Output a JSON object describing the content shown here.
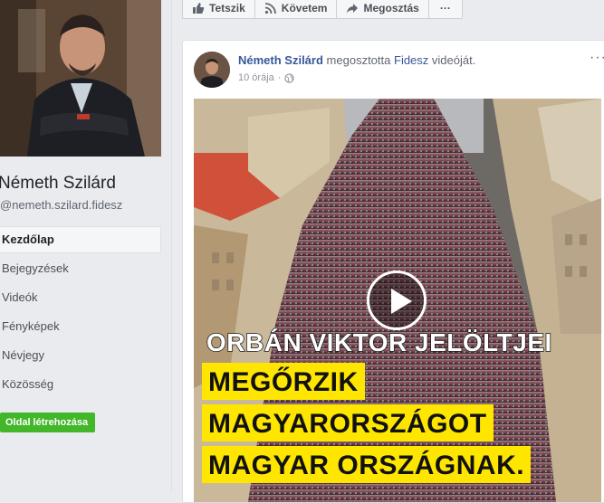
{
  "sidebar": {
    "page_name": "Németh Szilárd",
    "page_handle": "@nemeth.szilard.fidesz",
    "nav_items": [
      {
        "label": "Kezdőlap",
        "active": true
      },
      {
        "label": "Bejegyzések",
        "active": false
      },
      {
        "label": "Videók",
        "active": false
      },
      {
        "label": "Fényképek",
        "active": false
      },
      {
        "label": "Névjegy",
        "active": false
      },
      {
        "label": "Közösség",
        "active": false
      }
    ],
    "create_page_label": "Oldal létrehozása"
  },
  "action_bar": {
    "like_label": "Tetszik",
    "follow_label": "Követem",
    "share_label": "Megosztás",
    "more_label": "···"
  },
  "post": {
    "author": "Németh Szilárd",
    "shared_text": "megosztotta",
    "shared_source": "Fidesz",
    "shared_suffix": "videóját.",
    "timestamp": "10 órája",
    "menu_label": "···",
    "video": {
      "headline": "ORBÁN VIKTOR JELÖLTJEI",
      "lines": [
        "MEGŐRZIK",
        "MAGYARORSZÁGOT",
        "MAGYAR ORSZÁGNAK."
      ]
    }
  },
  "colors": {
    "link": "#365899",
    "create_button": "#42b72a",
    "highlight_yellow": "#ffe600"
  }
}
